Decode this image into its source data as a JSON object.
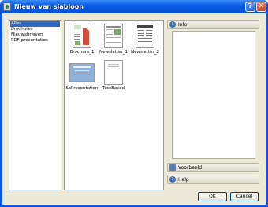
{
  "window": {
    "title": "Nieuw van sjabloon"
  },
  "categories": [
    {
      "label": "Alles",
      "selected": true
    },
    {
      "label": "Brochures",
      "selected": false
    },
    {
      "label": "Nieuwsbrieven",
      "selected": false
    },
    {
      "label": "PDF-presentaties",
      "selected": false
    }
  ],
  "templates": [
    {
      "name": "Brochure_1"
    },
    {
      "name": "Newsletter_1"
    },
    {
      "name": "Newsletter_2"
    },
    {
      "name": "ScPresentation"
    },
    {
      "name": "TextBased"
    }
  ],
  "panels": {
    "info": "Info",
    "preview": "Voorbeeld",
    "help": "Help"
  },
  "buttons": {
    "ok": "OK",
    "cancel": "Cancel"
  },
  "colors": {
    "titlebar": "#0a54e3",
    "selection": "#316ac5",
    "dialog_bg": "#ece9d8"
  }
}
